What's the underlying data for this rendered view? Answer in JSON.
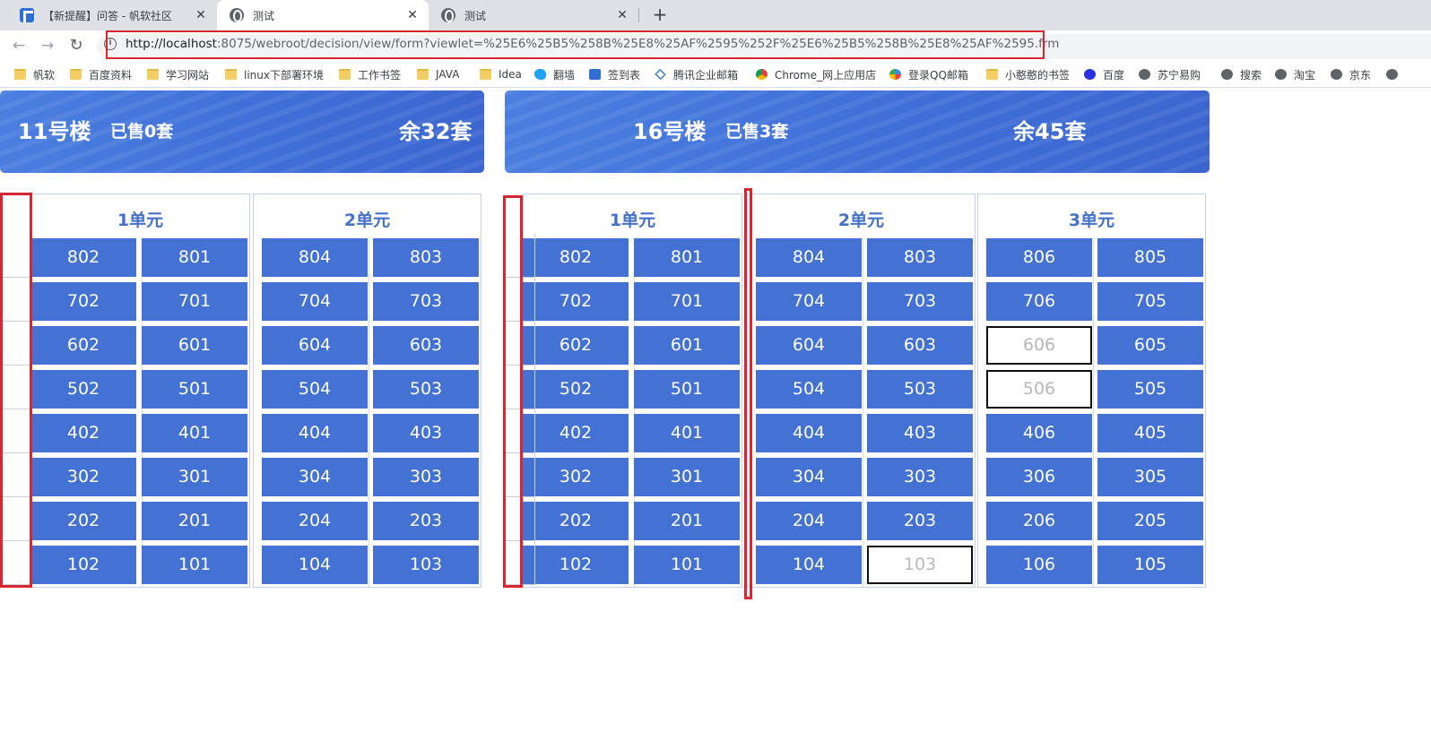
{
  "browser": {
    "tabs": [
      {
        "title": "【新提醒】问答 - 帆软社区",
        "icon": "fanruan-icon",
        "active": false
      },
      {
        "title": "测试",
        "icon": "globe-icon",
        "active": true
      },
      {
        "title": "测试",
        "icon": "globe-icon",
        "active": false
      }
    ],
    "url_host": "http://localhost",
    "url_rest": ":8075/webroot/decision/view/form?viewlet=%25E6%25B5%258B%25E8%25AF%2595%252F%25E6%25B5%258B%25E8%25AF%2595.frm",
    "bookmarks": [
      {
        "label": "帆软",
        "icon": "folder-icon"
      },
      {
        "label": "百度资料",
        "icon": "folder-icon"
      },
      {
        "label": "学习网站",
        "icon": "folder-icon"
      },
      {
        "label": "linux下部署环境",
        "icon": "folder-icon"
      },
      {
        "label": "工作书签",
        "icon": "folder-icon"
      },
      {
        "label": "JAVA",
        "icon": "folder-icon"
      },
      {
        "label": "Idea",
        "icon": "folder-icon"
      },
      {
        "label": "翻墙",
        "icon": "bird-icon"
      },
      {
        "label": "签到表",
        "icon": "fanruan-icon"
      },
      {
        "label": "腾讯企业邮箱",
        "icon": "mail-icon"
      },
      {
        "label": "Chrome_网上应用店",
        "icon": "chrome-icon"
      },
      {
        "label": "登录QQ邮箱",
        "icon": "qq-icon"
      },
      {
        "label": "小憨憨的书签",
        "icon": "folder-icon"
      },
      {
        "label": "百度",
        "icon": "paw-icon"
      },
      {
        "label": "苏宁易购",
        "icon": "globe-icon"
      },
      {
        "label": "搜索",
        "icon": "globe-icon"
      },
      {
        "label": "淘宝",
        "icon": "globe-icon"
      },
      {
        "label": "京东",
        "icon": "globe-icon"
      }
    ]
  },
  "colors": {
    "accent": "#4472d4",
    "highlight_red": "#d9252f",
    "empty_room_text": "#b8b8b8"
  },
  "buildings": [
    {
      "name": "11号楼",
      "sold": "已售0套",
      "remaining": "余32套",
      "units": [
        {
          "name": "1单元",
          "rows": [
            [
              "802",
              "801"
            ],
            [
              "702",
              "701"
            ],
            [
              "602",
              "601"
            ],
            [
              "502",
              "501"
            ],
            [
              "402",
              "401"
            ],
            [
              "302",
              "301"
            ],
            [
              "202",
              "201"
            ],
            [
              "102",
              "101"
            ]
          ],
          "empty": []
        },
        {
          "name": "2单元",
          "rows": [
            [
              "804",
              "803"
            ],
            [
              "704",
              "703"
            ],
            [
              "604",
              "603"
            ],
            [
              "504",
              "503"
            ],
            [
              "404",
              "403"
            ],
            [
              "304",
              "303"
            ],
            [
              "204",
              "203"
            ],
            [
              "104",
              "103"
            ]
          ],
          "empty": []
        }
      ]
    },
    {
      "name": "16号楼",
      "sold": "已售3套",
      "remaining": "余45套",
      "units": [
        {
          "name": "1单元",
          "rows": [
            [
              "802",
              "801"
            ],
            [
              "702",
              "701"
            ],
            [
              "602",
              "601"
            ],
            [
              "502",
              "501"
            ],
            [
              "402",
              "401"
            ],
            [
              "302",
              "301"
            ],
            [
              "202",
              "201"
            ],
            [
              "102",
              "101"
            ]
          ],
          "empty": []
        },
        {
          "name": "2单元",
          "rows": [
            [
              "804",
              "803"
            ],
            [
              "704",
              "703"
            ],
            [
              "604",
              "603"
            ],
            [
              "504",
              "503"
            ],
            [
              "404",
              "403"
            ],
            [
              "304",
              "303"
            ],
            [
              "204",
              "203"
            ],
            [
              "104",
              "103"
            ]
          ],
          "empty": [
            "103"
          ]
        },
        {
          "name": "3单元",
          "rows": [
            [
              "806",
              "805"
            ],
            [
              "706",
              "705"
            ],
            [
              "606",
              "605"
            ],
            [
              "506",
              "505"
            ],
            [
              "406",
              "405"
            ],
            [
              "306",
              "305"
            ],
            [
              "206",
              "205"
            ],
            [
              "106",
              "105"
            ]
          ],
          "empty": [
            "606",
            "506"
          ]
        }
      ]
    }
  ]
}
